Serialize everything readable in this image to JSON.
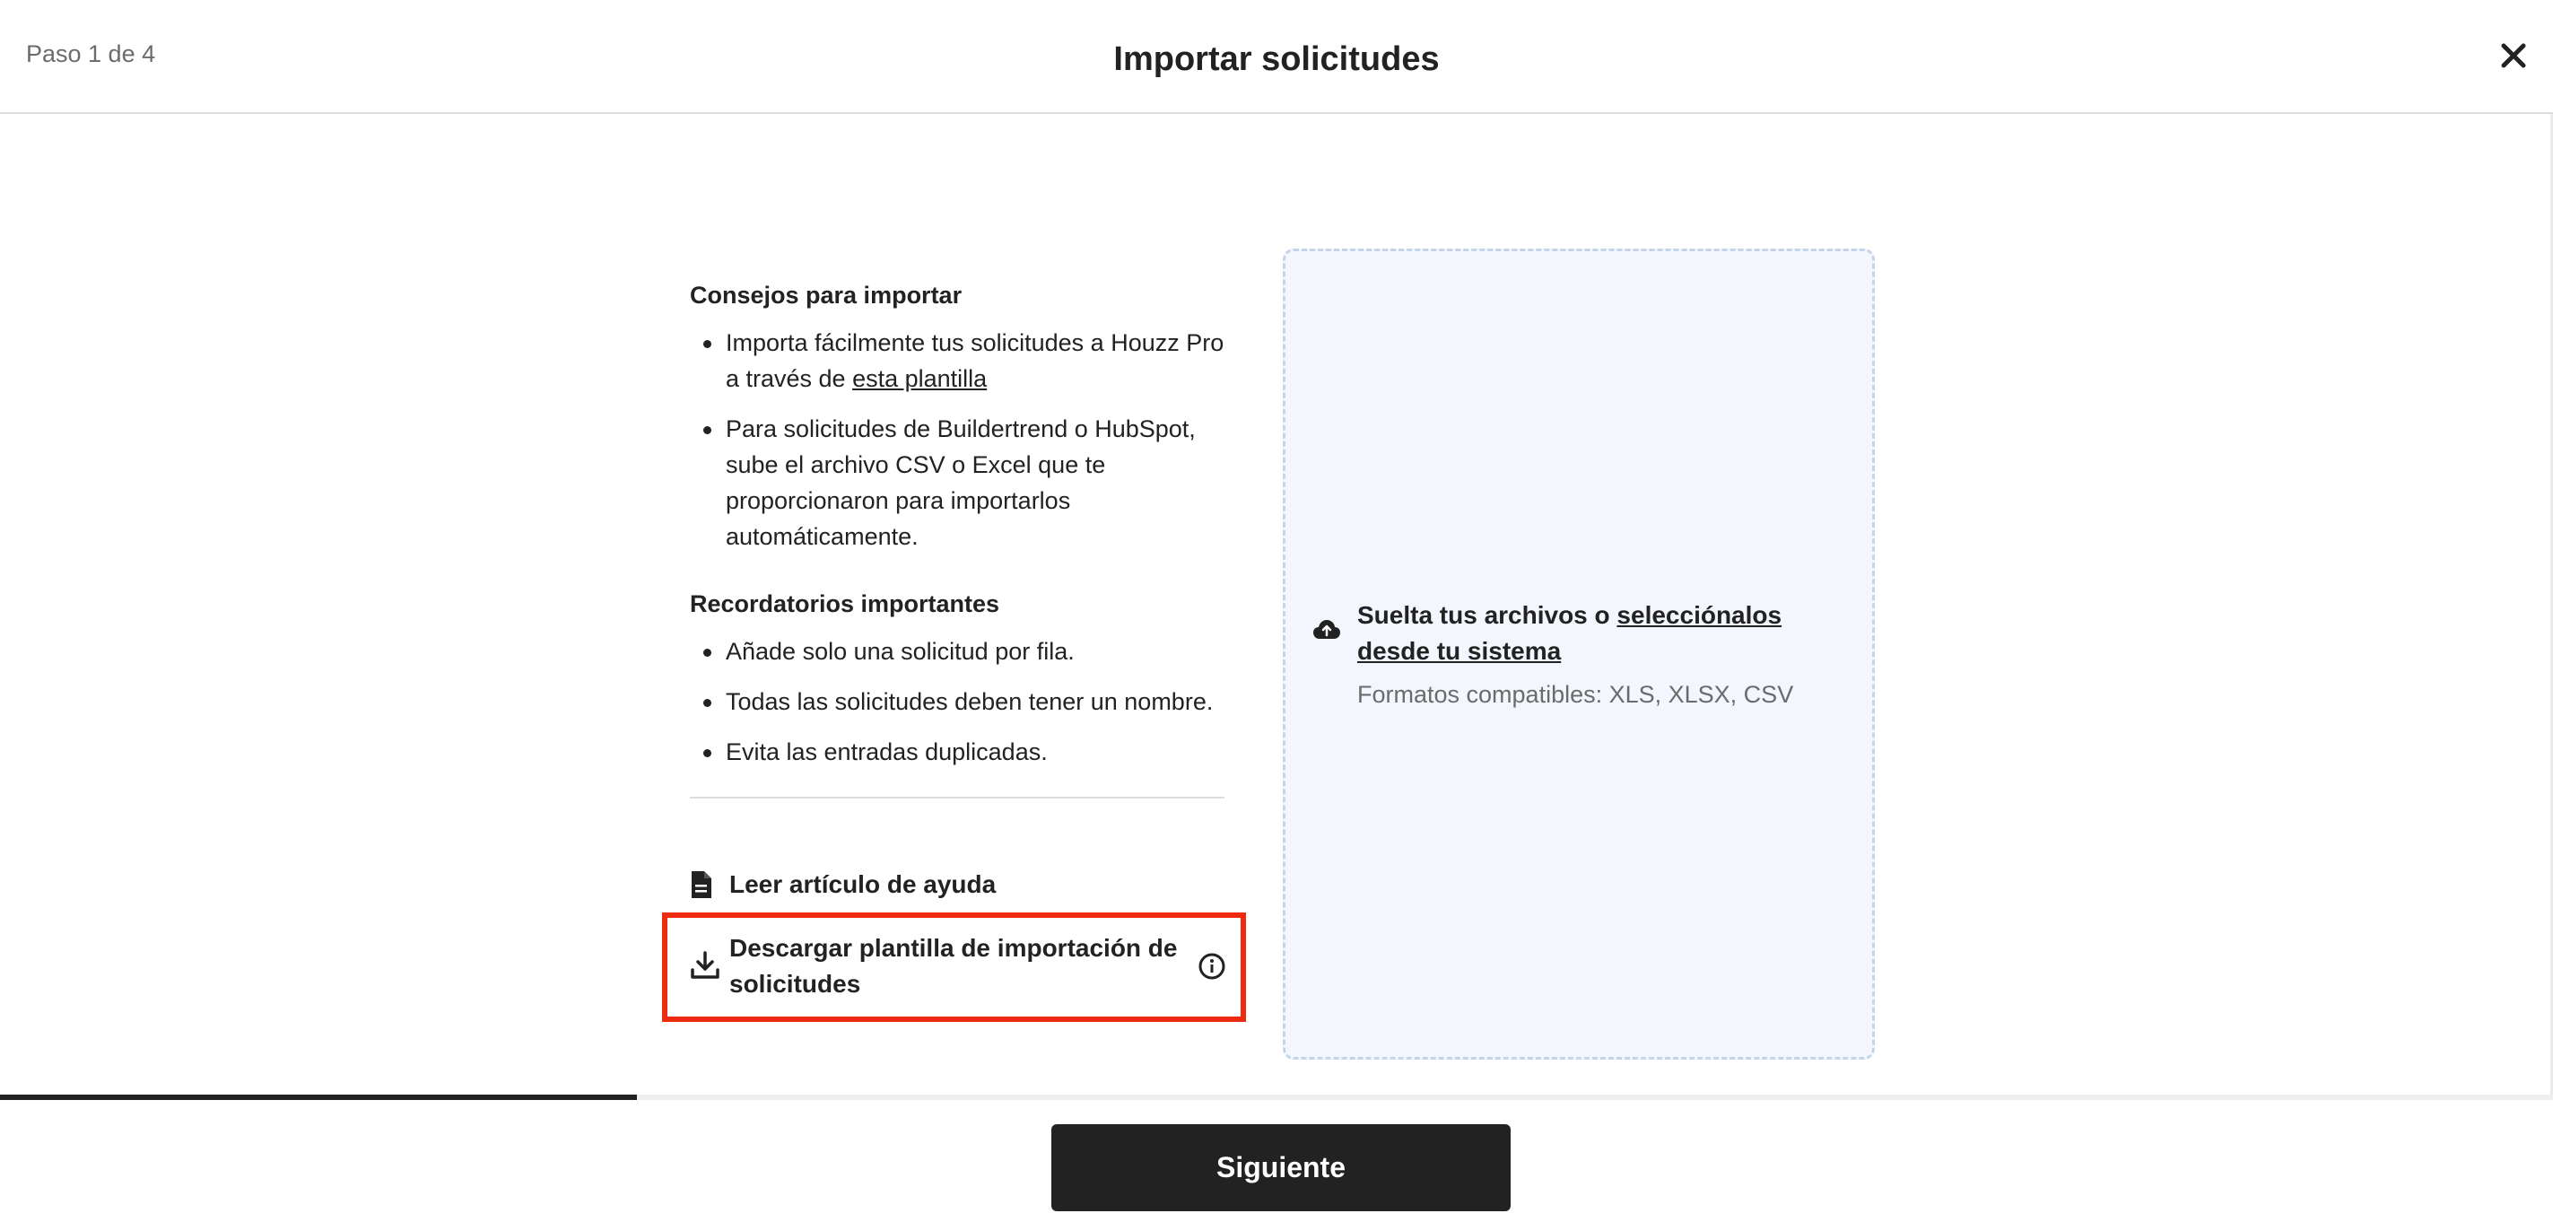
{
  "header": {
    "step": "Paso 1 de 4",
    "title": "Importar solicitudes",
    "close_icon": "close-icon"
  },
  "tips": {
    "title": "Consejos para importar",
    "item1_prefix": "Importa fácilmente tus solicitudes a Houzz Pro a través de ",
    "item1_link": "esta plantilla",
    "item2": "Para solicitudes de Buildertrend o HubSpot, sube el archivo CSV o Excel que te proporcionaron para importarlos automáticamente."
  },
  "reminders": {
    "title": "Recordatorios importantes",
    "items": [
      "Añade solo una solicitud por fila.",
      "Todas las solicitudes deben tener un nombre.",
      "Evita las entradas duplicadas."
    ]
  },
  "help": {
    "label": "Leer artículo de ayuda",
    "icon": "document-icon"
  },
  "download": {
    "label": "Descargar plantilla de importación de solicitudes",
    "icon": "download-icon",
    "info_icon": "info-icon",
    "highlight_color": "#ee2b0e"
  },
  "dropzone": {
    "prefix": "Suelta tus archivos o ",
    "link": "selecciónalos desde tu sistema",
    "formats": "Formatos compatibles: XLS, XLSX, CSV",
    "icon": "cloud-upload-icon"
  },
  "footer": {
    "next_label": "Siguiente",
    "progress_fraction": 0.25
  }
}
